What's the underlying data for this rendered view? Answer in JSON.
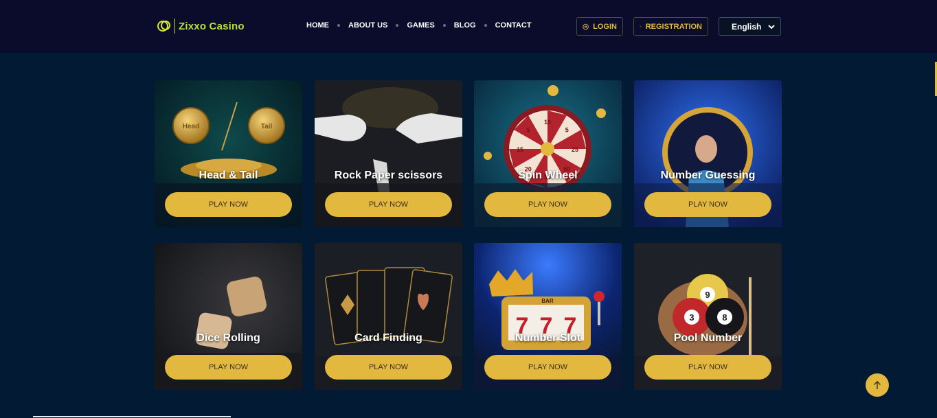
{
  "brand": {
    "name": "Zixxo Casino",
    "color": "#b8e23a"
  },
  "nav": {
    "items": [
      {
        "label": "HOME"
      },
      {
        "label": "ABOUT US"
      },
      {
        "label": "GAMES"
      },
      {
        "label": "BLOG"
      },
      {
        "label": "CONTACT"
      }
    ]
  },
  "auth": {
    "login_label": "LOGIN",
    "register_label": "REGISTRATION"
  },
  "language": {
    "selected": "English",
    "icon": "chevron-down-icon"
  },
  "accent_color": "#e3b83e",
  "games": [
    {
      "title": "Head & Tail",
      "button": "PLAY NOW",
      "coin_labels": [
        "Head",
        "Tail"
      ]
    },
    {
      "title": "Rock Paper scissors",
      "button": "PLAY NOW"
    },
    {
      "title": "Spin Wheel",
      "button": "PLAY NOW",
      "wheel_numbers": [
        "10",
        "5",
        "25",
        "50",
        "35",
        "20",
        "15",
        "5"
      ]
    },
    {
      "title": "Number Guessing",
      "button": "PLAY NOW"
    },
    {
      "title": "Dice Rolling",
      "button": "PLAY NOW"
    },
    {
      "title": "Card Finding",
      "button": "PLAY NOW"
    },
    {
      "title": "Number Slot",
      "button": "PLAY NOW",
      "reels": [
        "7",
        "7",
        "7"
      ],
      "bar_label": "BAR"
    },
    {
      "title": "Pool Number",
      "button": "PLAY NOW",
      "balls": [
        "9",
        "3",
        "8"
      ]
    }
  ],
  "scroll_top_icon": "arrow-up-icon"
}
